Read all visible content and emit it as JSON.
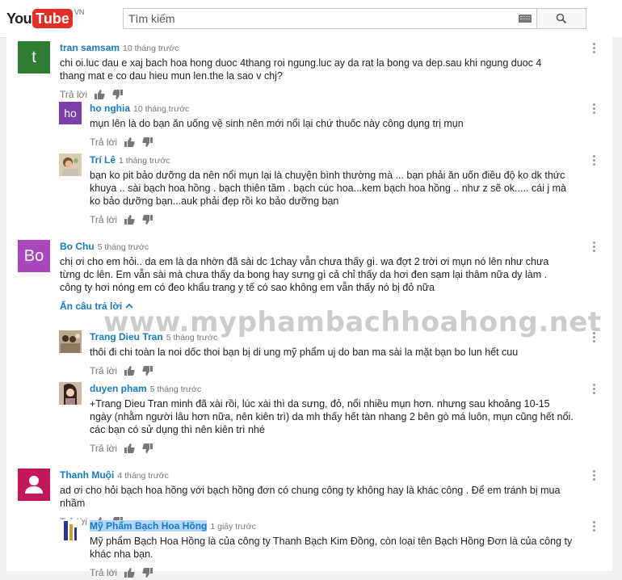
{
  "header": {
    "logo_you": "You",
    "logo_tube": "Tube",
    "logo_country": "VN",
    "search_placeholder": "Tìm kiếm"
  },
  "reply_label": "Trả lời",
  "watermark": "www.myphambachhoahong.net",
  "colors": {
    "link": "#167ac6",
    "brand": "#e52d27"
  },
  "comments": [
    {
      "author": "tran samsam",
      "time": "10 tháng trước",
      "avatar_letter": "t",
      "avatar_color": "#2e7d32",
      "text": "chi oi.luc dau e xaj bach hoa hong duoc 4thang roi ngung.luc ay da rat la bong va dep.sau khi ngung duoc 4 thang mat e co dau hieu mun len.the la sao v chj?",
      "replies": [
        {
          "author": "ho nghia",
          "time": "10 tháng trước",
          "avatar_letter": "ho",
          "avatar_color": "#7b3fa8",
          "text": "mụn lên là do bạn ăn uống vệ sinh nên mới nổi lại chứ thuốc này công dụng trị mụn"
        },
        {
          "author": "Trí Lê",
          "time": "1 tháng trước",
          "text": "bạn ko pit bảo dưỡng da nên nổi mụn lại là chuyện bình thường mà ... bạn phải ăn uốn điều độ ko dk thức khuya .. sài bạch hoa hồng . bạch thiên tầm . bạch cúc hoa...kem bạch hoa hồng .. như z sẽ ok..... cái j mà ko bảo dưỡng bạn...auk phải đẹp rồi ko bảo dưỡng bạn"
        }
      ]
    },
    {
      "author": "Bo Chu",
      "time": "5 tháng trước",
      "avatar_letter": "Bo",
      "avatar_color": "#ab47bc",
      "text": "chị ơi cho em hỏi.. da em là da nhờn đã sài dc 1chay vẫn chưa thấy gì. wa đợt 2 trời ơi mụn nó lên như chưa từng dc lên. Em vẫn sài mà chưa thấy da bong hay sưng gì cả chỉ thấy da hơi đen sạm lại thâm nữa dy làm . công ty hơi nóng em có đeo khẩu trang y tế có sao không em vẫn thấy nó bị đỏ nữa",
      "hide_label": "Ẩn câu trả lời",
      "replies": [
        {
          "author": "Trang Dieu Tran",
          "time": "5 tháng trước",
          "text": "thôi đi chi toàn la noi dốc thoi bạn bị di ung mỹ phẩm uj do ban ma sài la mặt bạn bo lun hết cuu"
        },
        {
          "author": "duyen pham",
          "time": "5 tháng trước",
          "text": "+Trang Dieu Tran minh đã xài rồi, lúc xài thì da sưng, đỏ, nổi nhiều mụn hơn. nhưng sau khoảng 10-15 ngày (nhằm người lâu hơn nữa, nên kiên trì) da mh thấy hết tàn nhang 2 bên gò má luôn, mụn cũng hết nổi. các bạn có sử dụng thì nên kiên trì nhé"
        }
      ]
    },
    {
      "author": "Thanh Muội",
      "time": "4 tháng trước",
      "avatar_color": "#c2185b",
      "text": "ad ơi cho hỏi bạch hoa hồng với bạch hồng đơn có chung công ty không hay là khác công . Để em tránh bị mua nhầm",
      "replies": [
        {
          "author": "Mỹ Phẩm Bạch Hoa Hồng",
          "time": "1 giây trước",
          "text": "Mỹ phẩm Bạch Hoa Hồng là của công ty Thanh Bạch Kim Đồng, còn loại tên Bạch Hồng Đơn là của công ty khác nha bạn."
        }
      ]
    }
  ]
}
